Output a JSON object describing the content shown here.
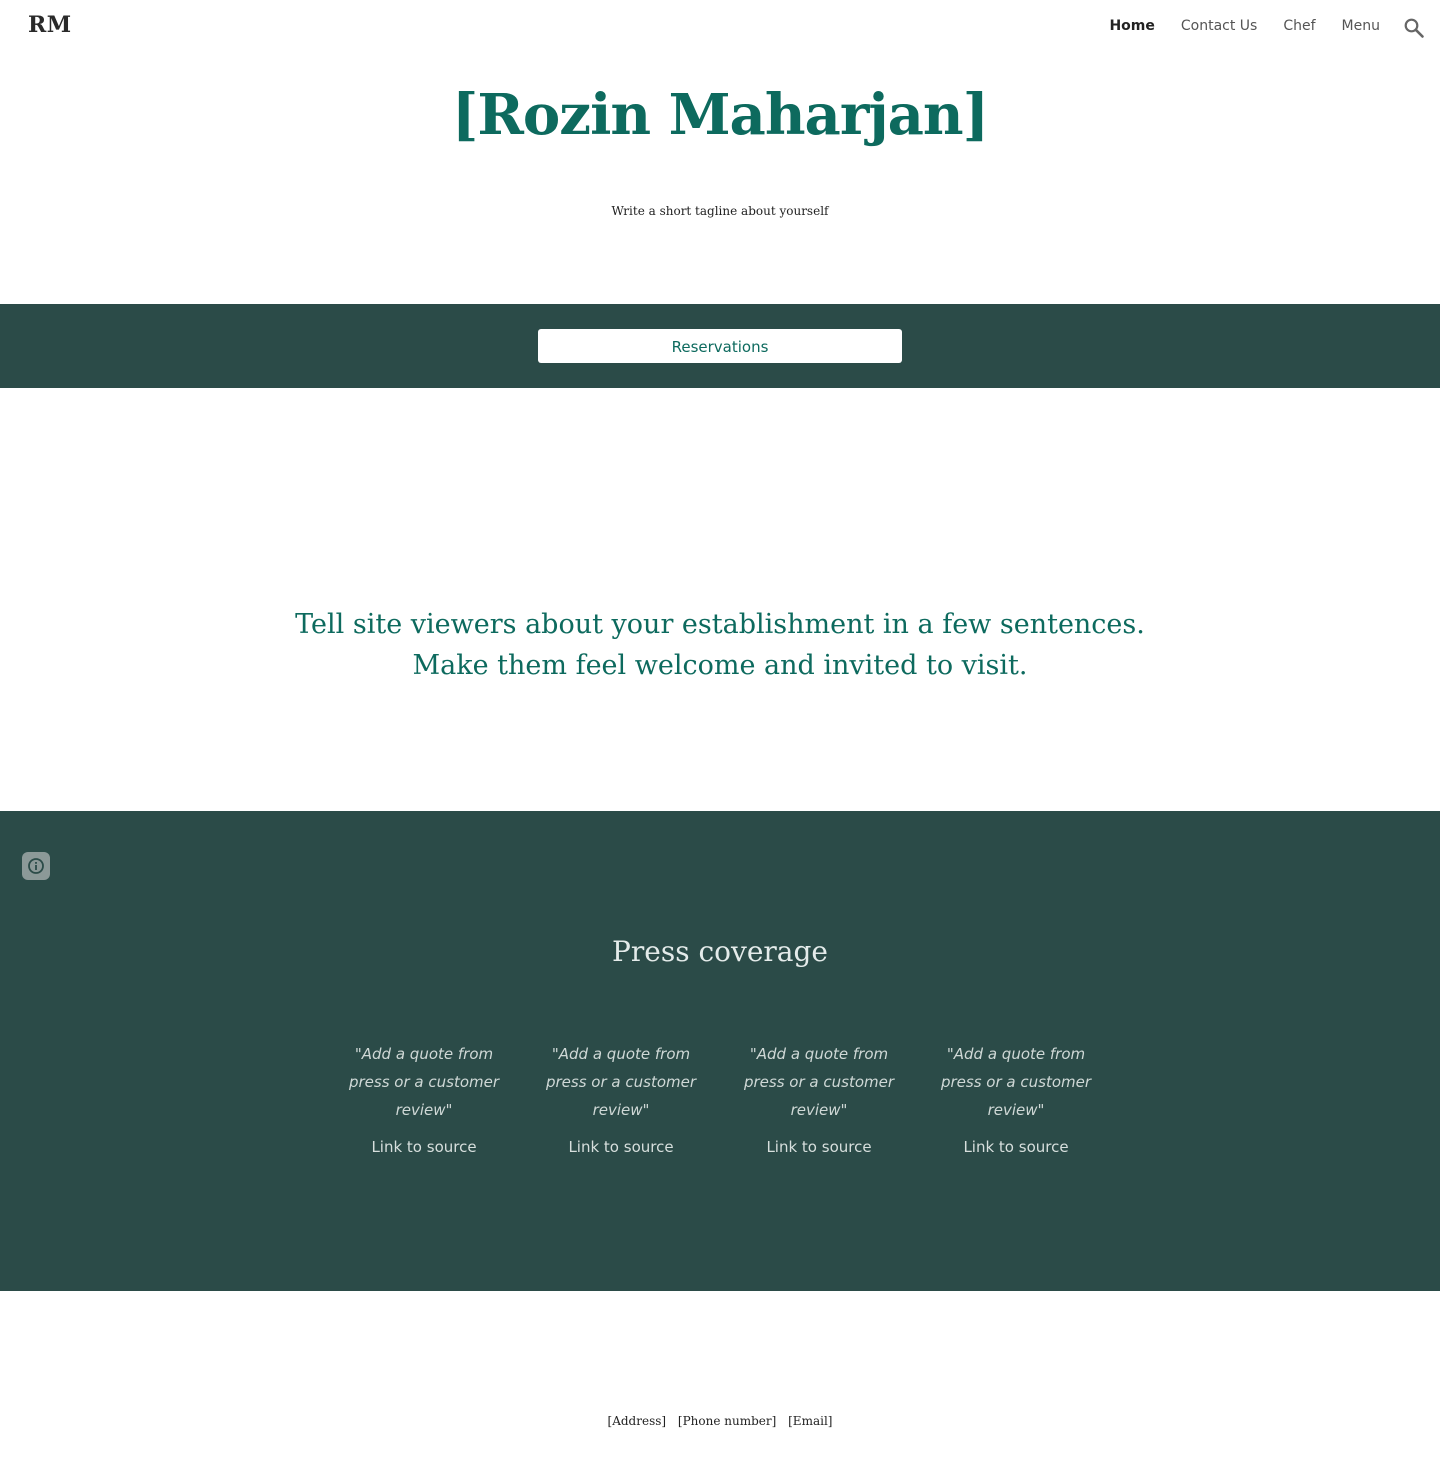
{
  "header": {
    "logo": "RM",
    "nav": [
      {
        "label": "Home",
        "active": true
      },
      {
        "label": "Contact Us",
        "active": false
      },
      {
        "label": "Chef",
        "active": false
      },
      {
        "label": "Menu",
        "active": false
      }
    ],
    "search_icon": "search-icon"
  },
  "hero": {
    "title": "[Rozin Maharjan]",
    "tagline": "Write a short tagline about yourself"
  },
  "reservations": {
    "button_label": "Reservations"
  },
  "intro": {
    "line1": "Tell site viewers about your establishment in a few sentences.",
    "line2": "Make them feel welcome and invited to visit."
  },
  "press": {
    "info_icon": "info-icon",
    "title": "Press coverage",
    "quotes": [
      {
        "line1": "\"Add a quote from",
        "line2": "press or a customer",
        "line3": "review\"",
        "link": "Link to source"
      },
      {
        "line1": "\"Add a quote from",
        "line2": "press or a customer",
        "line3": "review\"",
        "link": "Link to source"
      },
      {
        "line1": "\"Add a quote from",
        "line2": "press or a customer",
        "line3": "review\"",
        "link": "Link to source"
      },
      {
        "line1": "\"Add a quote from",
        "line2": "press or a customer",
        "line3": "review\"",
        "link": "Link to source"
      }
    ]
  },
  "footer": {
    "address": "[Address]",
    "phone": "[Phone number]",
    "email": "[Email]"
  },
  "colors": {
    "accent": "#0d6a5e",
    "band": "#2b4b48",
    "background": "#ffffff"
  }
}
